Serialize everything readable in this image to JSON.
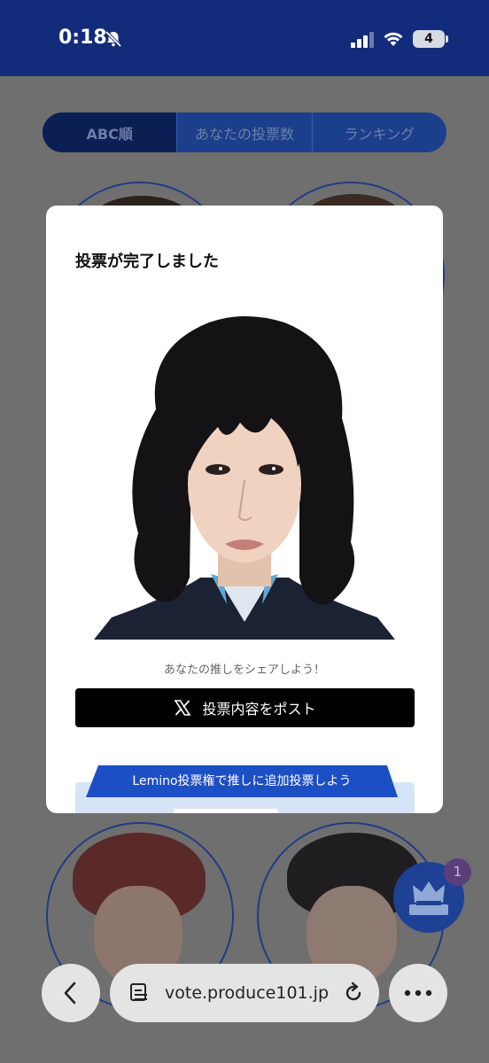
{
  "status_bar": {
    "time": "0:18",
    "battery": "4"
  },
  "tabs": [
    {
      "label": "ABC順"
    },
    {
      "label": "あなたの投票数"
    },
    {
      "label": "ランキング"
    }
  ],
  "modal": {
    "title": "投票が完了しました",
    "share_text": "あなたの推しをシェアしよう！",
    "post_button": "投票内容をポスト",
    "lemino_banner": "Lemino投票権で推しに追加投票しよう"
  },
  "fab": {
    "badge": "1"
  },
  "browser": {
    "url": "vote.produce101.jp"
  },
  "colors": {
    "header": "#122b7a",
    "tab_bg": "#1c3f8c",
    "fab": "#1e4196",
    "banner": "#1d4fc4"
  }
}
